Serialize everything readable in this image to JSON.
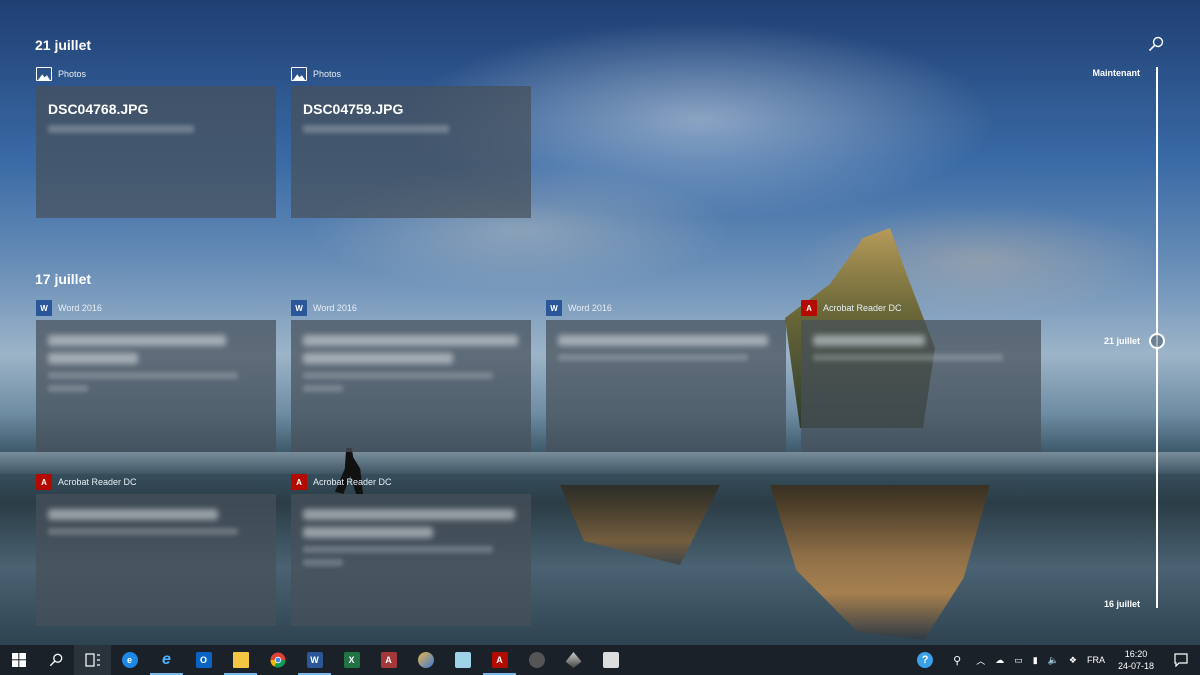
{
  "timeline": {
    "search_icon": "search-icon",
    "labels": {
      "top": "Maintenant",
      "middle": "21 juillet",
      "bottom": "16 juillet"
    }
  },
  "sections": [
    {
      "date": "21 juillet",
      "cards": [
        {
          "app": "Photos",
          "icon": "photos-icon",
          "title": "DSC04768.JPG"
        },
        {
          "app": "Photos",
          "icon": "photos-icon",
          "title": "DSC04759.JPG"
        }
      ]
    },
    {
      "date": "17 juillet",
      "cards": [
        {
          "app": "Word 2016",
          "icon": "word-icon"
        },
        {
          "app": "Word 2016",
          "icon": "word-icon"
        },
        {
          "app": "Word 2016",
          "icon": "word-icon"
        },
        {
          "app": "Acrobat Reader DC",
          "icon": "acrobat-icon"
        },
        {
          "app": "Acrobat Reader DC",
          "icon": "acrobat-icon"
        },
        {
          "app": "Acrobat Reader DC",
          "icon": "acrobat-icon"
        }
      ]
    }
  ],
  "taskbar": {
    "pinned": [
      "start-icon",
      "search-icon",
      "task-view-icon",
      "edge-icon",
      "internet-explorer-icon",
      "outlook-icon",
      "file-explorer-icon",
      "chrome-icon",
      "word-icon",
      "excel-icon",
      "access-icon",
      "paint-icon",
      "notepad-icon",
      "acrobat-icon",
      "app-icon",
      "vpn-icon",
      "snipping-icon"
    ],
    "tray": {
      "language": "FRA",
      "time": "16:20",
      "date": "24-07-18"
    }
  },
  "colors": {
    "card_bg": "#46505a",
    "word": "#2b579a",
    "acrobat": "#b30b00",
    "taskbar": "#1b2128",
    "active_indicator": "#76b9ed"
  }
}
